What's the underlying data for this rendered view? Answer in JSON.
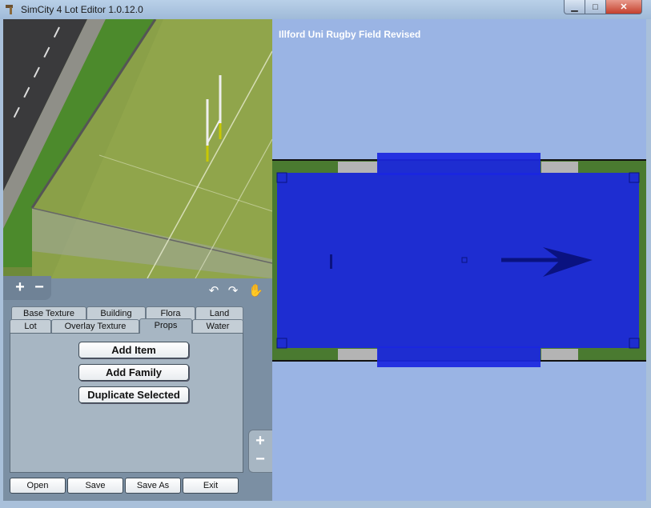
{
  "window": {
    "title": "SimCity 4 Lot Editor 1.0.12.0",
    "minimize_glyph": "▁",
    "maximize_glyph": "□",
    "close_glyph": "✕"
  },
  "icons": {
    "app": "hammer-icon",
    "zoom_in": "+",
    "zoom_out": "−",
    "rotate_left": "↶",
    "rotate_right": "↷",
    "hand": "✋"
  },
  "tabs": {
    "row_back": [
      "Base Texture",
      "Building",
      "Flora",
      "Land"
    ],
    "row_front": [
      "Lot",
      "Overlay Texture",
      "Props",
      "Water"
    ],
    "active": "Props"
  },
  "props_panel": {
    "add_item": "Add Item",
    "add_family": "Add Family",
    "duplicate_selected": "Duplicate Selected"
  },
  "bottom_buttons": [
    "Open",
    "Save",
    "Save As",
    "Exit"
  ],
  "canvas": {
    "lot_title": "Illford Uni Rugby Field Revised"
  },
  "colors": {
    "canvas_bg": "#9ab4e4",
    "selection_blue": "#1a26e0",
    "panel_bg": "#7b8fa3"
  }
}
